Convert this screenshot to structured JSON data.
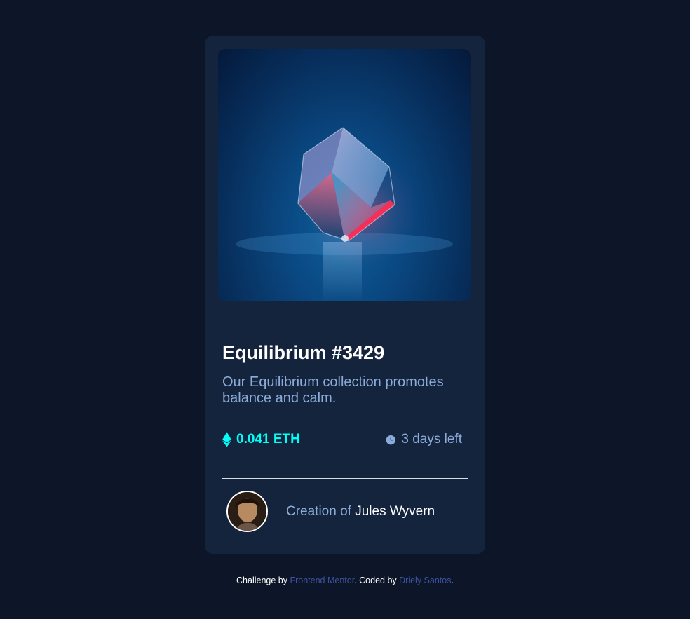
{
  "card": {
    "title": "Equilibrium #3429",
    "description": "Our Equilibrium collection promotes balance and calm.",
    "price": "0.041 ETH",
    "time_left": "3 days left",
    "creator_prefix": "Creation of",
    "creator_name": "Jules Wyvern"
  },
  "icons": {
    "price": "ethereum-icon",
    "time": "clock-icon",
    "image": "equilibrium-cube-image",
    "avatar": "creator-avatar"
  },
  "footer": {
    "prefix": "Challenge by",
    "challenge_link": "Frontend Mentor",
    "middle": ". Coded by",
    "coder_link": "Driely Santos",
    "suffix": "."
  },
  "colors": {
    "page_background": "#0d1628",
    "card_background": "#15243d",
    "accent_cyan": "#00fff8",
    "soft_blue": "#8bacd9",
    "white": "#ffffff",
    "link_blue": "#3e52a3"
  }
}
